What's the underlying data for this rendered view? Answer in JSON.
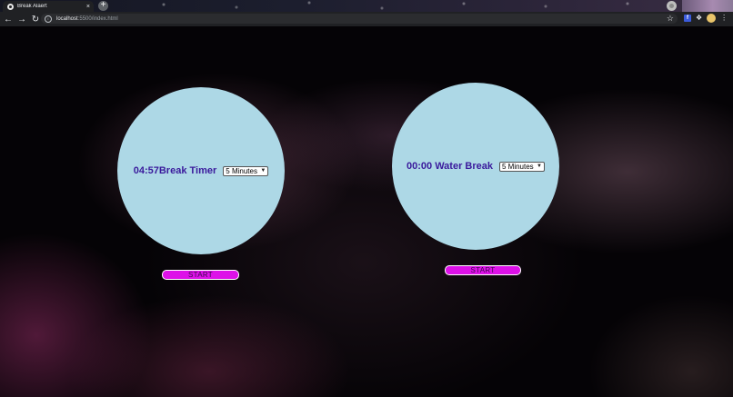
{
  "browser": {
    "tab_title": "Break Alaert",
    "tab_close": "×",
    "new_tab": "+",
    "url_host": "localhost",
    "url_path": ":5500/index.html",
    "extension_fb_label": "f"
  },
  "timers": [
    {
      "display": "04:57Break Timer",
      "select_value": "5 Minutes",
      "start_label": "START"
    },
    {
      "display": "00:00 Water Break",
      "select_value": "5 Minutes",
      "start_label": "START"
    }
  ],
  "colors": {
    "circle": "#add8e6",
    "timer_text": "#3a1a9c",
    "start_button": "#dd11e8"
  },
  "icons": {
    "back": "arrow-left-icon",
    "forward": "arrow-right-icon",
    "reload": "reload-icon",
    "info": "info-icon",
    "bookmark": "star-icon",
    "extensions": "puzzle-icon"
  }
}
